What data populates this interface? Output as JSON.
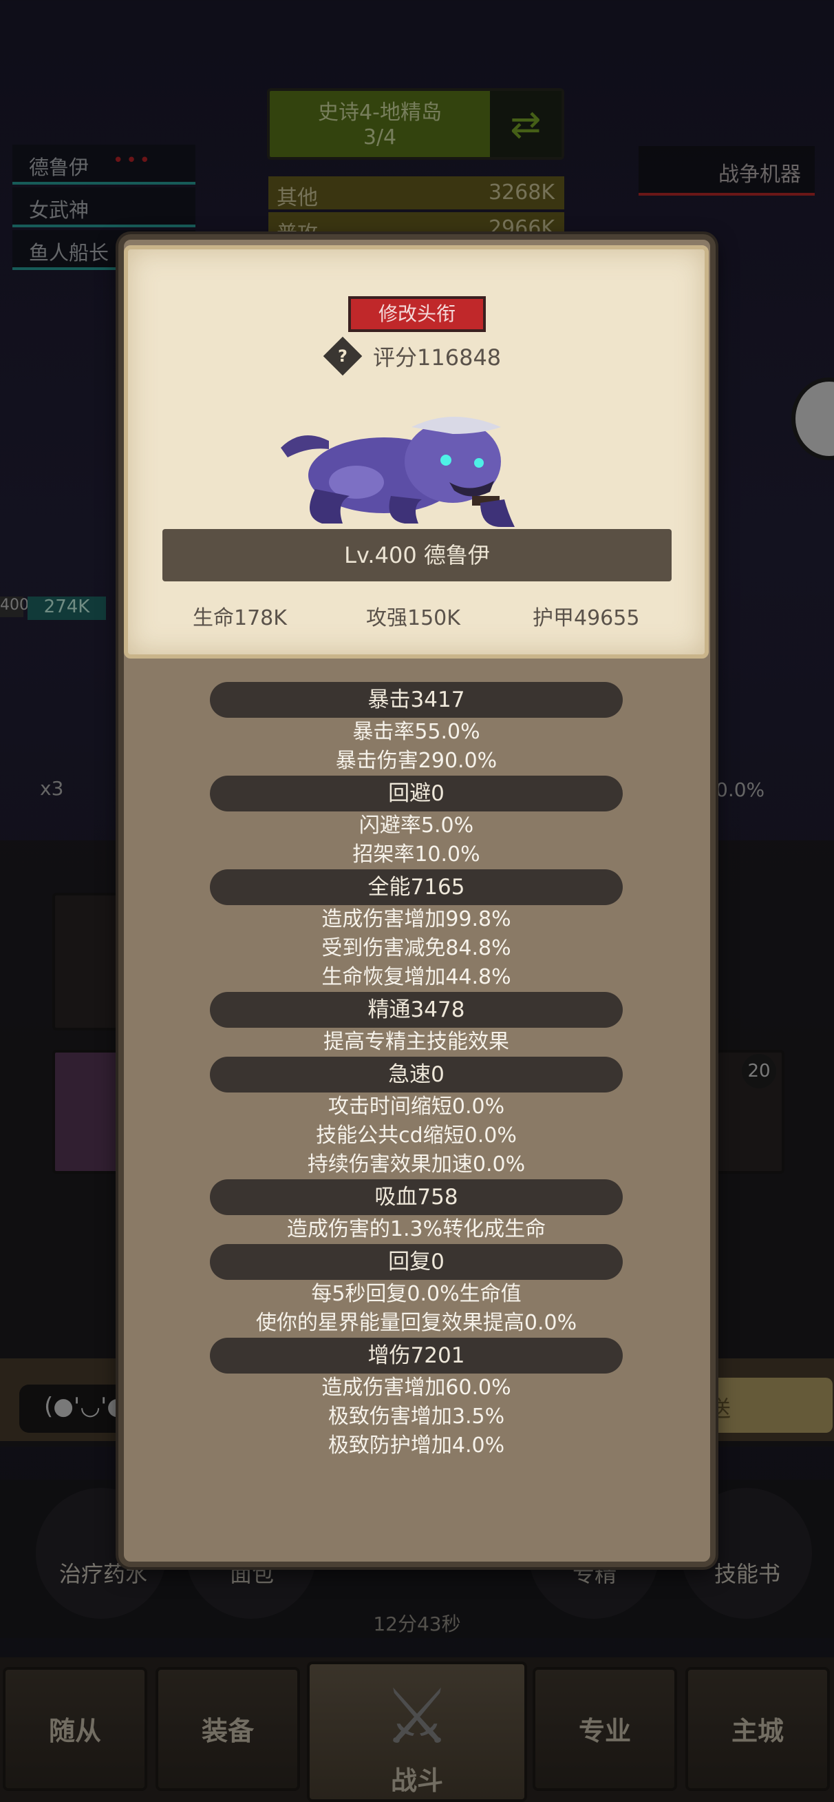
{
  "background": {
    "stage": {
      "name": "史诗4-地精岛",
      "progress": "3/4",
      "refresh_icon": "refresh-arrows-icon"
    },
    "team": [
      {
        "name": "德鲁伊",
        "dots": "•••"
      },
      {
        "name": "女武神",
        "dots": ""
      },
      {
        "name": "鱼人船长",
        "dots": ""
      }
    ],
    "dps_board": [
      {
        "label": "其他",
        "value": "3268K"
      },
      {
        "label": "普攻",
        "value": "2966K"
      }
    ],
    "enemy_name": "战争机器",
    "small_level": "400",
    "small_hp": "274K",
    "multiplier": "x3",
    "right_percent": "0.0%",
    "badge_count": "20",
    "chat_emote": "(●'◡'●",
    "send_label": "送",
    "items": [
      {
        "label": "治疗药水"
      },
      {
        "label": "面包"
      },
      {
        "label": "专精"
      },
      {
        "label": "技能书"
      }
    ],
    "timer": "12分43秒",
    "nav": {
      "followers": "随从",
      "equipment": "装备",
      "battle": "战斗",
      "profession": "专业",
      "main_city": "主城"
    }
  },
  "modal": {
    "change_title_label": "修改头衔",
    "score_label": "评分116848",
    "hero_name": "Lv.400 德鲁伊",
    "stats": {
      "hp": "生命178K",
      "attack": "攻强150K",
      "armor": "护甲49655"
    },
    "attribute_groups": [
      {
        "header": "暴击3417",
        "lines": [
          "暴击率55.0%",
          "暴击伤害290.0%"
        ]
      },
      {
        "header": "回避0",
        "lines": [
          "闪避率5.0%",
          "招架率10.0%"
        ]
      },
      {
        "header": "全能7165",
        "lines": [
          "造成伤害增加99.8%",
          "受到伤害减免84.8%",
          "生命恢复增加44.8%"
        ]
      },
      {
        "header": "精通3478",
        "lines": [
          "提高专精主技能效果"
        ]
      },
      {
        "header": "急速0",
        "lines": [
          "攻击时间缩短0.0%",
          "技能公共cd缩短0.0%",
          "持续伤害效果加速0.0%"
        ]
      },
      {
        "header": "吸血758",
        "lines": [
          "造成伤害的1.3%转化成生命"
        ]
      },
      {
        "header": "回复0",
        "lines": [
          "每5秒回复0.0%生命值",
          "使你的星界能量回复效果提高0.0%"
        ]
      },
      {
        "header": "增伤7201",
        "lines": [
          "造成伤害增加60.0%",
          "极致伤害增加3.5%",
          "极致防护增加4.0%"
        ]
      }
    ]
  },
  "colors": {
    "title_button": "#c0282a",
    "parchment": "#efe4cb",
    "frame": "#8a7a66"
  }
}
